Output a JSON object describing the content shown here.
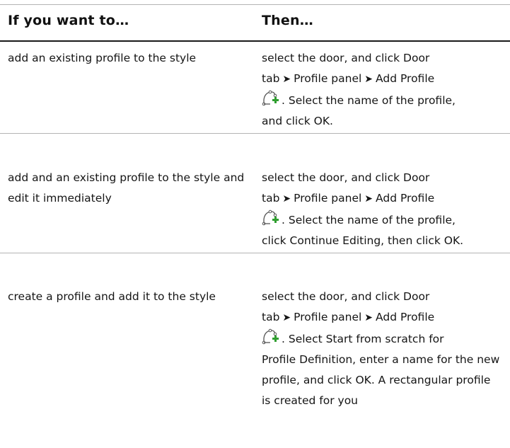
{
  "header": {
    "col1": "If you want to…",
    "col2": "Then…"
  },
  "rows": [
    {
      "want": "add an existing profile to the style",
      "then_line1": "select the door, and click Door",
      "then_tab": "tab",
      "then_panel": "Profile panel",
      "then_cmd": "Add Profile",
      "then_after_icon": ". Select the name of the profile,",
      "then_rest": "and click OK."
    },
    {
      "want": "add and an existing profile to the style and edit it immediately",
      "then_line1": "select the door, and click Door",
      "then_tab": "tab",
      "then_panel": "Profile panel",
      "then_cmd": "Add Profile",
      "then_after_icon": ". Select the name of the profile,",
      "then_rest": "click Continue Editing, then click OK."
    },
    {
      "want": "create a profile and add it to the style",
      "then_line1": "select the door, and click Door",
      "then_tab": "tab",
      "then_panel": "Profile panel",
      "then_cmd": "Add Profile",
      "then_after_icon": ". Select Start from scratch for",
      "then_rest": "Profile Definition, enter a name for the new profile, and click OK. A rectangular profile is created for you"
    }
  ],
  "icons": {
    "arrow": "➤",
    "add_profile_icon": "add-profile-icon"
  },
  "colors": {
    "header_rule": "#1a1a1a",
    "row_rule": "#b4b4b4",
    "icon_plus": "#2f9e2f"
  }
}
